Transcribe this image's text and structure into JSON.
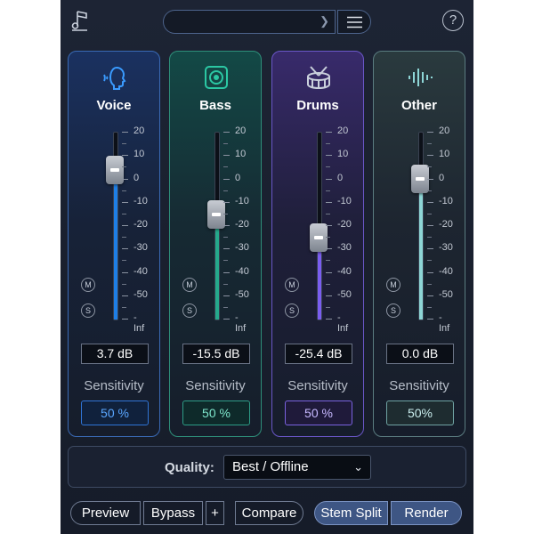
{
  "header": {
    "app_icon": "music-note-icon",
    "preset_value": "",
    "preset_chevron": "chevron-down-icon",
    "menu_icon": "hamburger-menu-icon",
    "help_label": "?"
  },
  "stems": [
    {
      "name": "Voice",
      "icon": "voice-head-icon",
      "db": "3.7 dB",
      "fader_db": 3.7,
      "sensitivity_label": "Sensitivity",
      "sensitivity": "50 %",
      "accent": "#1e7fe6",
      "mute": "M",
      "solo": "S"
    },
    {
      "name": "Bass",
      "icon": "speaker-icon",
      "db": "-15.5 dB",
      "fader_db": -15.5,
      "sensitivity_label": "Sensitivity",
      "sensitivity": "50 %",
      "accent": "#25a98c",
      "mute": "M",
      "solo": "S"
    },
    {
      "name": "Drums",
      "icon": "drum-icon",
      "db": "-25.4 dB",
      "fader_db": -25.4,
      "sensitivity_label": "Sensitivity",
      "sensitivity": "50 %",
      "accent": "#7a5df0",
      "mute": "M",
      "solo": "S"
    },
    {
      "name": "Other",
      "icon": "waveform-icon",
      "db": "0.0 dB",
      "fader_db": 0.0,
      "sensitivity_label": "Sensitivity",
      "sensitivity": "50%",
      "accent": "#8ed6d6",
      "mute": "M",
      "solo": "S"
    }
  ],
  "scale_labels": [
    "20",
    "10",
    "0",
    "-10",
    "-20",
    "-30",
    "-40",
    "-50",
    "-Inf"
  ],
  "quality": {
    "label": "Quality:",
    "value": "Best / Offline"
  },
  "footer": {
    "preview": "Preview",
    "bypass": "Bypass",
    "plus": "+",
    "compare": "Compare",
    "stem_split": "Stem Split",
    "render": "Render"
  }
}
